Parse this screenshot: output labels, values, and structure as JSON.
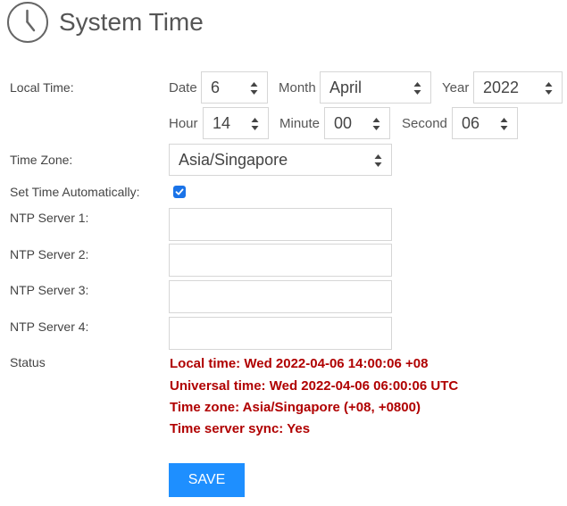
{
  "page": {
    "title": "System Time",
    "icon": "clock-icon"
  },
  "local_time": {
    "label": "Local Time:",
    "date_label": "Date",
    "date_value": "6",
    "month_label": "Month",
    "month_value": "April",
    "year_label": "Year",
    "year_value": "2022",
    "hour_label": "Hour",
    "hour_value": "14",
    "minute_label": "Minute",
    "minute_value": "00",
    "second_label": "Second",
    "second_value": "06"
  },
  "time_zone": {
    "label": "Time Zone:",
    "value": "Asia/Singapore"
  },
  "auto_time": {
    "label": "Set Time Automatically:",
    "checked": true
  },
  "ntp": {
    "server1_label": "NTP Server 1:",
    "server1_value": "",
    "server2_label": "NTP Server 2:",
    "server2_value": "",
    "server3_label": "NTP Server 3:",
    "server3_value": "",
    "server4_label": "NTP Server 4:",
    "server4_value": ""
  },
  "status": {
    "label": "Status",
    "lines": [
      "Local time: Wed 2022-04-06 14:00:06 +08",
      "Universal time: Wed 2022-04-06 06:00:06 UTC",
      "Time zone: Asia/Singapore (+08, +0800)",
      "Time server sync: Yes"
    ]
  },
  "actions": {
    "save_label": "SAVE"
  },
  "colors": {
    "status_text": "#b00000",
    "save_button": "#1e8fff",
    "checkbox": "#1a73e8"
  }
}
